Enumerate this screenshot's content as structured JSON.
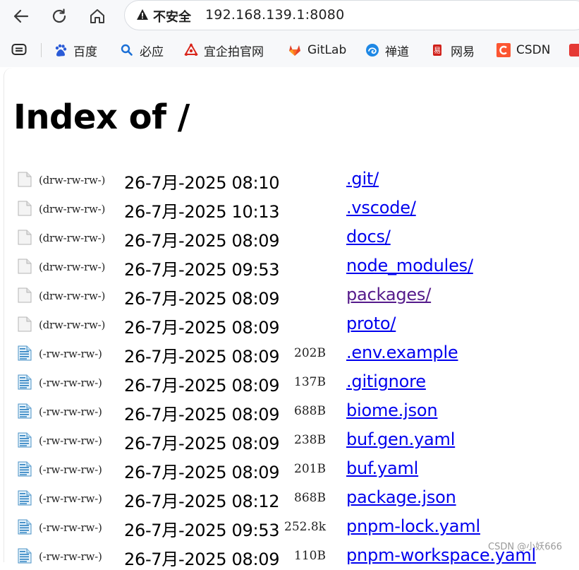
{
  "browser": {
    "security_label": "不安全",
    "url": "192.168.139.1:8080",
    "bookmarks": [
      {
        "label": "百度",
        "icon": "baidu-paw-icon"
      },
      {
        "label": "必应",
        "icon": "search-icon"
      },
      {
        "label": "宜企拍官网",
        "icon": "triangle-logo-icon"
      },
      {
        "label": "GitLab",
        "icon": "gitlab-fox-icon"
      },
      {
        "label": "禅道",
        "icon": "zentao-swirl-icon"
      },
      {
        "label": "网易",
        "icon": "netease-logo-icon"
      },
      {
        "label": "CSDN",
        "icon": "csdn-c-icon"
      }
    ]
  },
  "page": {
    "title": "Index of /",
    "entries": [
      {
        "perm": "(drw-rw-rw-)",
        "date": "26-7月-2025 08:10",
        "size": "",
        "name": ".git/",
        "type": "dir",
        "visited": false
      },
      {
        "perm": "(drw-rw-rw-)",
        "date": "26-7月-2025 10:13",
        "size": "",
        "name": ".vscode/",
        "type": "dir",
        "visited": false
      },
      {
        "perm": "(drw-rw-rw-)",
        "date": "26-7月-2025 08:09",
        "size": "",
        "name": "docs/",
        "type": "dir",
        "visited": false
      },
      {
        "perm": "(drw-rw-rw-)",
        "date": "26-7月-2025 09:53",
        "size": "",
        "name": "node_modules/",
        "type": "dir",
        "visited": false
      },
      {
        "perm": "(drw-rw-rw-)",
        "date": "26-7月-2025 08:09",
        "size": "",
        "name": "packages/",
        "type": "dir",
        "visited": true
      },
      {
        "perm": "(drw-rw-rw-)",
        "date": "26-7月-2025 08:09",
        "size": "",
        "name": "proto/",
        "type": "dir",
        "visited": false
      },
      {
        "perm": "(-rw-rw-rw-)",
        "date": "26-7月-2025 08:09",
        "size": "202B",
        "name": ".env.example",
        "type": "file",
        "visited": false
      },
      {
        "perm": "(-rw-rw-rw-)",
        "date": "26-7月-2025 08:09",
        "size": "137B",
        "name": ".gitignore",
        "type": "file",
        "visited": false
      },
      {
        "perm": "(-rw-rw-rw-)",
        "date": "26-7月-2025 08:09",
        "size": "688B",
        "name": "biome.json",
        "type": "file",
        "visited": false
      },
      {
        "perm": "(-rw-rw-rw-)",
        "date": "26-7月-2025 08:09",
        "size": "238B",
        "name": "buf.gen.yaml",
        "type": "file",
        "visited": false
      },
      {
        "perm": "(-rw-rw-rw-)",
        "date": "26-7月-2025 08:09",
        "size": "201B",
        "name": "buf.yaml",
        "type": "file",
        "visited": false
      },
      {
        "perm": "(-rw-rw-rw-)",
        "date": "26-7月-2025 08:12",
        "size": "868B",
        "name": "package.json",
        "type": "file",
        "visited": false
      },
      {
        "perm": "(-rw-rw-rw-)",
        "date": "26-7月-2025 09:53",
        "size": "252.8k",
        "name": "pnpm-lock.yaml",
        "type": "file",
        "visited": false
      },
      {
        "perm": "(-rw-rw-rw-)",
        "date": "26-7月-2025 08:09",
        "size": "110B",
        "name": "pnpm-workspace.yaml",
        "type": "file",
        "visited": false
      }
    ]
  },
  "watermark": "CSDN @小妖666",
  "colors": {
    "link": "#0000ee",
    "visited": "#551a8b"
  }
}
